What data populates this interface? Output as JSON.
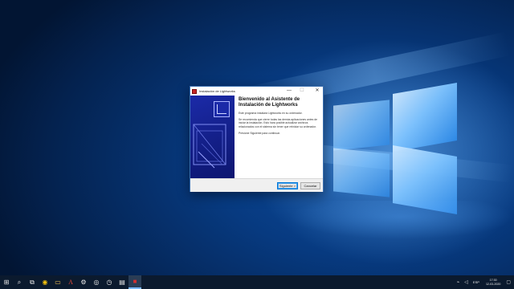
{
  "installer": {
    "window_title": "Instalación de Lightworks",
    "minimize_glyph": "—",
    "maximize_glyph": "☐",
    "close_glyph": "✕",
    "heading_line1": "Bienvenido al Asistente de",
    "heading_line2": "Instalación de Lightworks",
    "para1": "Este programa instalará Lightworks en su ordenador.",
    "para2": "Se recomienda que cierre todas las demás aplicaciones antes de iniciar la instalación. Esto hará posible actualizar archivos relacionados con el sistema sin tener que reiniciar su ordenador.",
    "para3": "Presione Siguiente para continuar.",
    "next_label": "Siguiente >",
    "cancel_label": "Cancelar",
    "banner_color": "#1b2aa8"
  },
  "taskbar": {
    "start_glyph": "⊞",
    "search_glyph": "⌕",
    "taskview_glyph": "⧉",
    "apps": [
      {
        "name": "chrome",
        "glyph": "◉"
      },
      {
        "name": "file-explorer",
        "glyph": "▭"
      },
      {
        "name": "font-app",
        "glyph": "A"
      },
      {
        "name": "settings",
        "glyph": "⚙"
      },
      {
        "name": "camera",
        "glyph": "◎"
      },
      {
        "name": "clock",
        "glyph": "◷"
      },
      {
        "name": "document",
        "glyph": "▤"
      },
      {
        "name": "lightworks",
        "glyph": "■"
      }
    ],
    "tray": {
      "network_glyph": "⌁",
      "volume_glyph": "◁",
      "language": "ESP",
      "time": "17:30",
      "date": "12-03-2020",
      "notification_glyph": "▢"
    }
  },
  "colors": {
    "accent": "#0078d7",
    "taskbar_bg": "#0b1a2e"
  }
}
